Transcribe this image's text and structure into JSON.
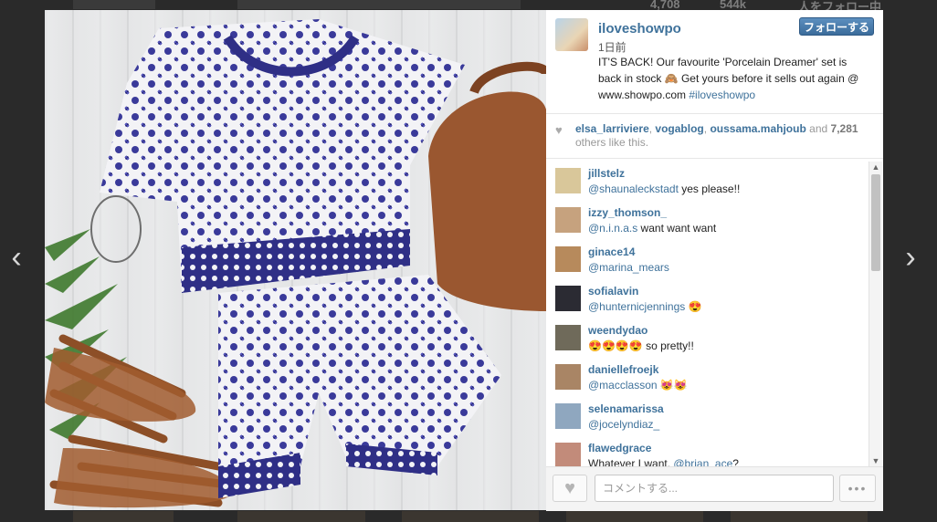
{
  "background": {
    "stats": [
      "4,708",
      "544k",
      "人をフォロー中"
    ]
  },
  "post": {
    "username": "iloveshowpo",
    "timestamp": "1日前",
    "follow_label": "フォローする",
    "caption_text": "IT'S BACK! Our favourite 'Porcelain Dreamer' set is back in stock 🙈 Get yours before it sells out again @ www.showpo.com ",
    "caption_tag": "#iloveshowpo"
  },
  "likes": {
    "users": [
      "elsa_larriviere",
      "vogablog",
      "oussama.mahjoub"
    ],
    "and_label": "and",
    "count": "7,281",
    "suffix": "others like this."
  },
  "comments": [
    {
      "user": "jillstelz",
      "mention": "@shaunaleckstadt",
      "text": " yes please!!",
      "avatar_color": "#d9c79a"
    },
    {
      "user": "izzy_thomson_",
      "mention": "@n.i.n.a.s",
      "text": " want want want",
      "avatar_color": "#c6a27e"
    },
    {
      "user": "ginace14",
      "mention": "@marina_mears",
      "text": "",
      "avatar_color": "#b78a5c"
    },
    {
      "user": "sofialavin",
      "mention": "@hunternicjennings",
      "text": " 😍",
      "avatar_color": "#2b2b33"
    },
    {
      "user": "weendydao",
      "mention": "",
      "text": "😍😍😍😍 so pretty!!",
      "avatar_color": "#6f6a5a"
    },
    {
      "user": "daniellefroejk",
      "mention": "@macclasson",
      "text": " 😻😻",
      "avatar_color": "#a98565"
    },
    {
      "user": "selenamarissa",
      "mention": "@jocelyndiaz_",
      "text": "",
      "avatar_color": "#8fa7bf"
    },
    {
      "user": "flawedgrace",
      "mention": "@brian_ace",
      "text_before": "Whatever I want. ",
      "text": "?",
      "avatar_color": "#c28b7a"
    }
  ],
  "footer": {
    "comment_placeholder": "コメントする...",
    "more_label": "•••"
  },
  "icons": {
    "nav_left": "chevron-left-icon",
    "nav_right": "chevron-right-icon",
    "like": "heart-icon",
    "more": "ellipsis-icon"
  },
  "colors": {
    "link": "#3f729b",
    "follow_button": "#3b6c9b"
  }
}
